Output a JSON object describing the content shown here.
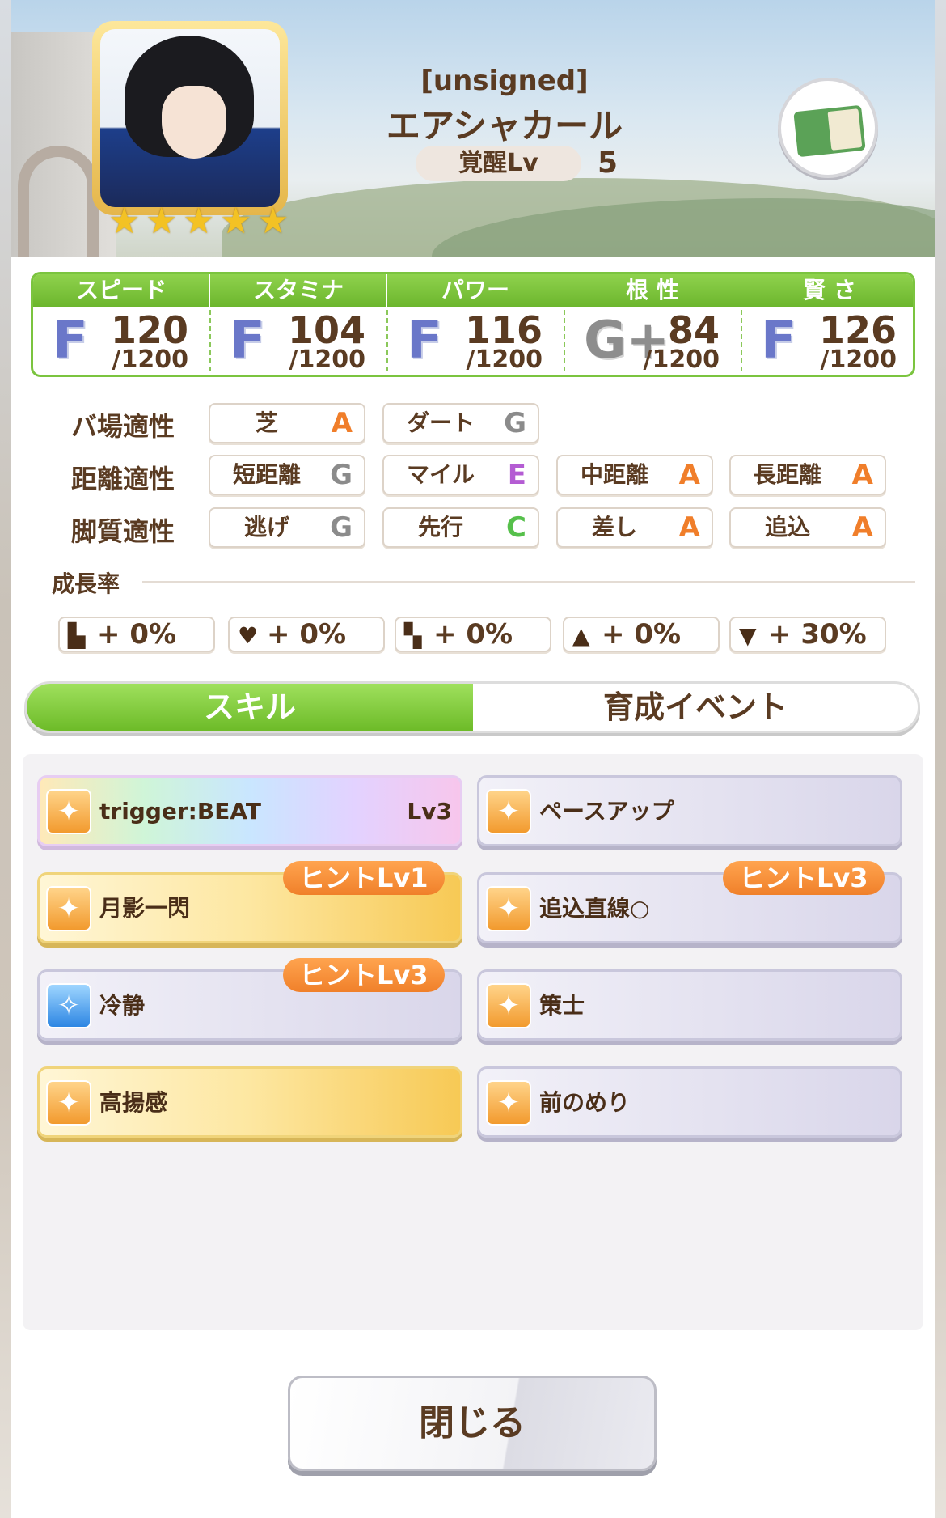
{
  "header": {
    "player_name": "[unsigned]",
    "character_name": "エアシャカール",
    "awakening_label": "覚醒Lv",
    "awakening_value": "5",
    "stars": [
      "★",
      "★",
      "★",
      "★",
      "★"
    ]
  },
  "stats": [
    {
      "label": "スピード",
      "icon": "shoe-icon",
      "grade": "F",
      "value": "120",
      "max": "/1200"
    },
    {
      "label": "スタミナ",
      "icon": "heart-icon",
      "grade": "F",
      "value": "104",
      "max": "/1200"
    },
    {
      "label": "パワー",
      "icon": "muscle-icon",
      "grade": "F",
      "value": "116",
      "max": "/1200"
    },
    {
      "label": "根 性",
      "icon": "flame-icon",
      "grade": "G+",
      "value": "84",
      "max": "/1200"
    },
    {
      "label": "賢 さ",
      "icon": "graduation-cap-icon",
      "grade": "F",
      "value": "126",
      "max": "/1200"
    }
  ],
  "aptitudes": {
    "track": {
      "label": "バ場適性",
      "items": [
        {
          "name": "芝",
          "grade": "A"
        },
        {
          "name": "ダート",
          "grade": "G"
        }
      ]
    },
    "distance": {
      "label": "距離適性",
      "items": [
        {
          "name": "短距離",
          "grade": "G"
        },
        {
          "name": "マイル",
          "grade": "E"
        },
        {
          "name": "中距離",
          "grade": "A"
        },
        {
          "name": "長距離",
          "grade": "A"
        }
      ]
    },
    "strategy": {
      "label": "脚質適性",
      "items": [
        {
          "name": "逃げ",
          "grade": "G"
        },
        {
          "name": "先行",
          "grade": "C"
        },
        {
          "name": "差し",
          "grade": "A"
        },
        {
          "name": "追込",
          "grade": "A"
        }
      ]
    }
  },
  "growth": {
    "label": "成長率",
    "items": [
      "+ 0%",
      "+ 0%",
      "+ 0%",
      "+ 0%",
      "+ 30%"
    ]
  },
  "tabs": {
    "skill": "スキル",
    "event": "育成イベント"
  },
  "skills": [
    {
      "name": "trigger:BEAT",
      "level": "Lv3",
      "hint": ""
    },
    {
      "name": "ペースアップ",
      "level": "",
      "hint": ""
    },
    {
      "name": "月影一閃",
      "level": "",
      "hint": "ヒントLv1"
    },
    {
      "name": "追込直線○",
      "level": "",
      "hint": "ヒントLv3"
    },
    {
      "name": "冷静",
      "level": "",
      "hint": "ヒントLv3"
    },
    {
      "name": "策士",
      "level": "",
      "hint": ""
    },
    {
      "name": "高揚感",
      "level": "",
      "hint": ""
    },
    {
      "name": "前のめり",
      "level": "",
      "hint": ""
    }
  ],
  "close_button": "閉じる",
  "colors": {
    "accent_green": "#7bc43f",
    "hint_orange": "#f0802a",
    "text_brown": "#5a3b22"
  }
}
